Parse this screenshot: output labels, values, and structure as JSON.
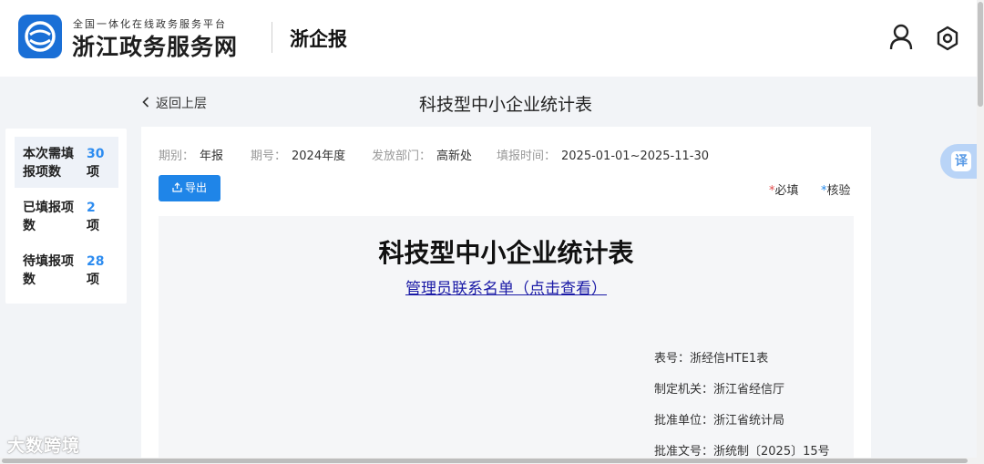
{
  "header": {
    "platform_subtitle": "全国一体化在线政务服务平台",
    "platform_name": "浙江政务服务网",
    "sub_brand": "浙企报",
    "icons": [
      "user-icon",
      "settings-icon"
    ]
  },
  "nav": {
    "back_label": "返回上层",
    "page_title": "科技型中小企业统计表"
  },
  "stats": [
    {
      "label": "本次需填报项数",
      "value": "30",
      "unit": "项"
    },
    {
      "label": "已填报项数",
      "value": "2",
      "unit": "项"
    },
    {
      "label": "待填报项数",
      "value": "28",
      "unit": "项"
    }
  ],
  "meta": {
    "period_type_label": "期别：",
    "period_type_value": "年报",
    "period_label": "期号：",
    "period_value": "2024年度",
    "dept_label": "发放部门：",
    "dept_value": "高新处",
    "time_label": "填报时间：",
    "time_value": "2025-01-01~2025-11-30"
  },
  "toolbar": {
    "export_label": "导出",
    "required_label": "必填",
    "verify_label": "核验"
  },
  "form": {
    "title": "科技型中小企业统计表",
    "contact_link": "管理员联系名单（点击查看）",
    "table_no": "表号：浙经信HTE1表",
    "issuer": "制定机关：浙江省经信厅",
    "approver": "批准单位：浙江省统计局",
    "approval_no": "批准文号：浙统制〔2025〕15号"
  },
  "translate_label": "译",
  "watermark": "大数跨境",
  "colors": {
    "accent": "#1f85e8",
    "stat_number": "#2d8cf0",
    "required_star": "#e24a4a",
    "link": "#1a1aa6"
  }
}
